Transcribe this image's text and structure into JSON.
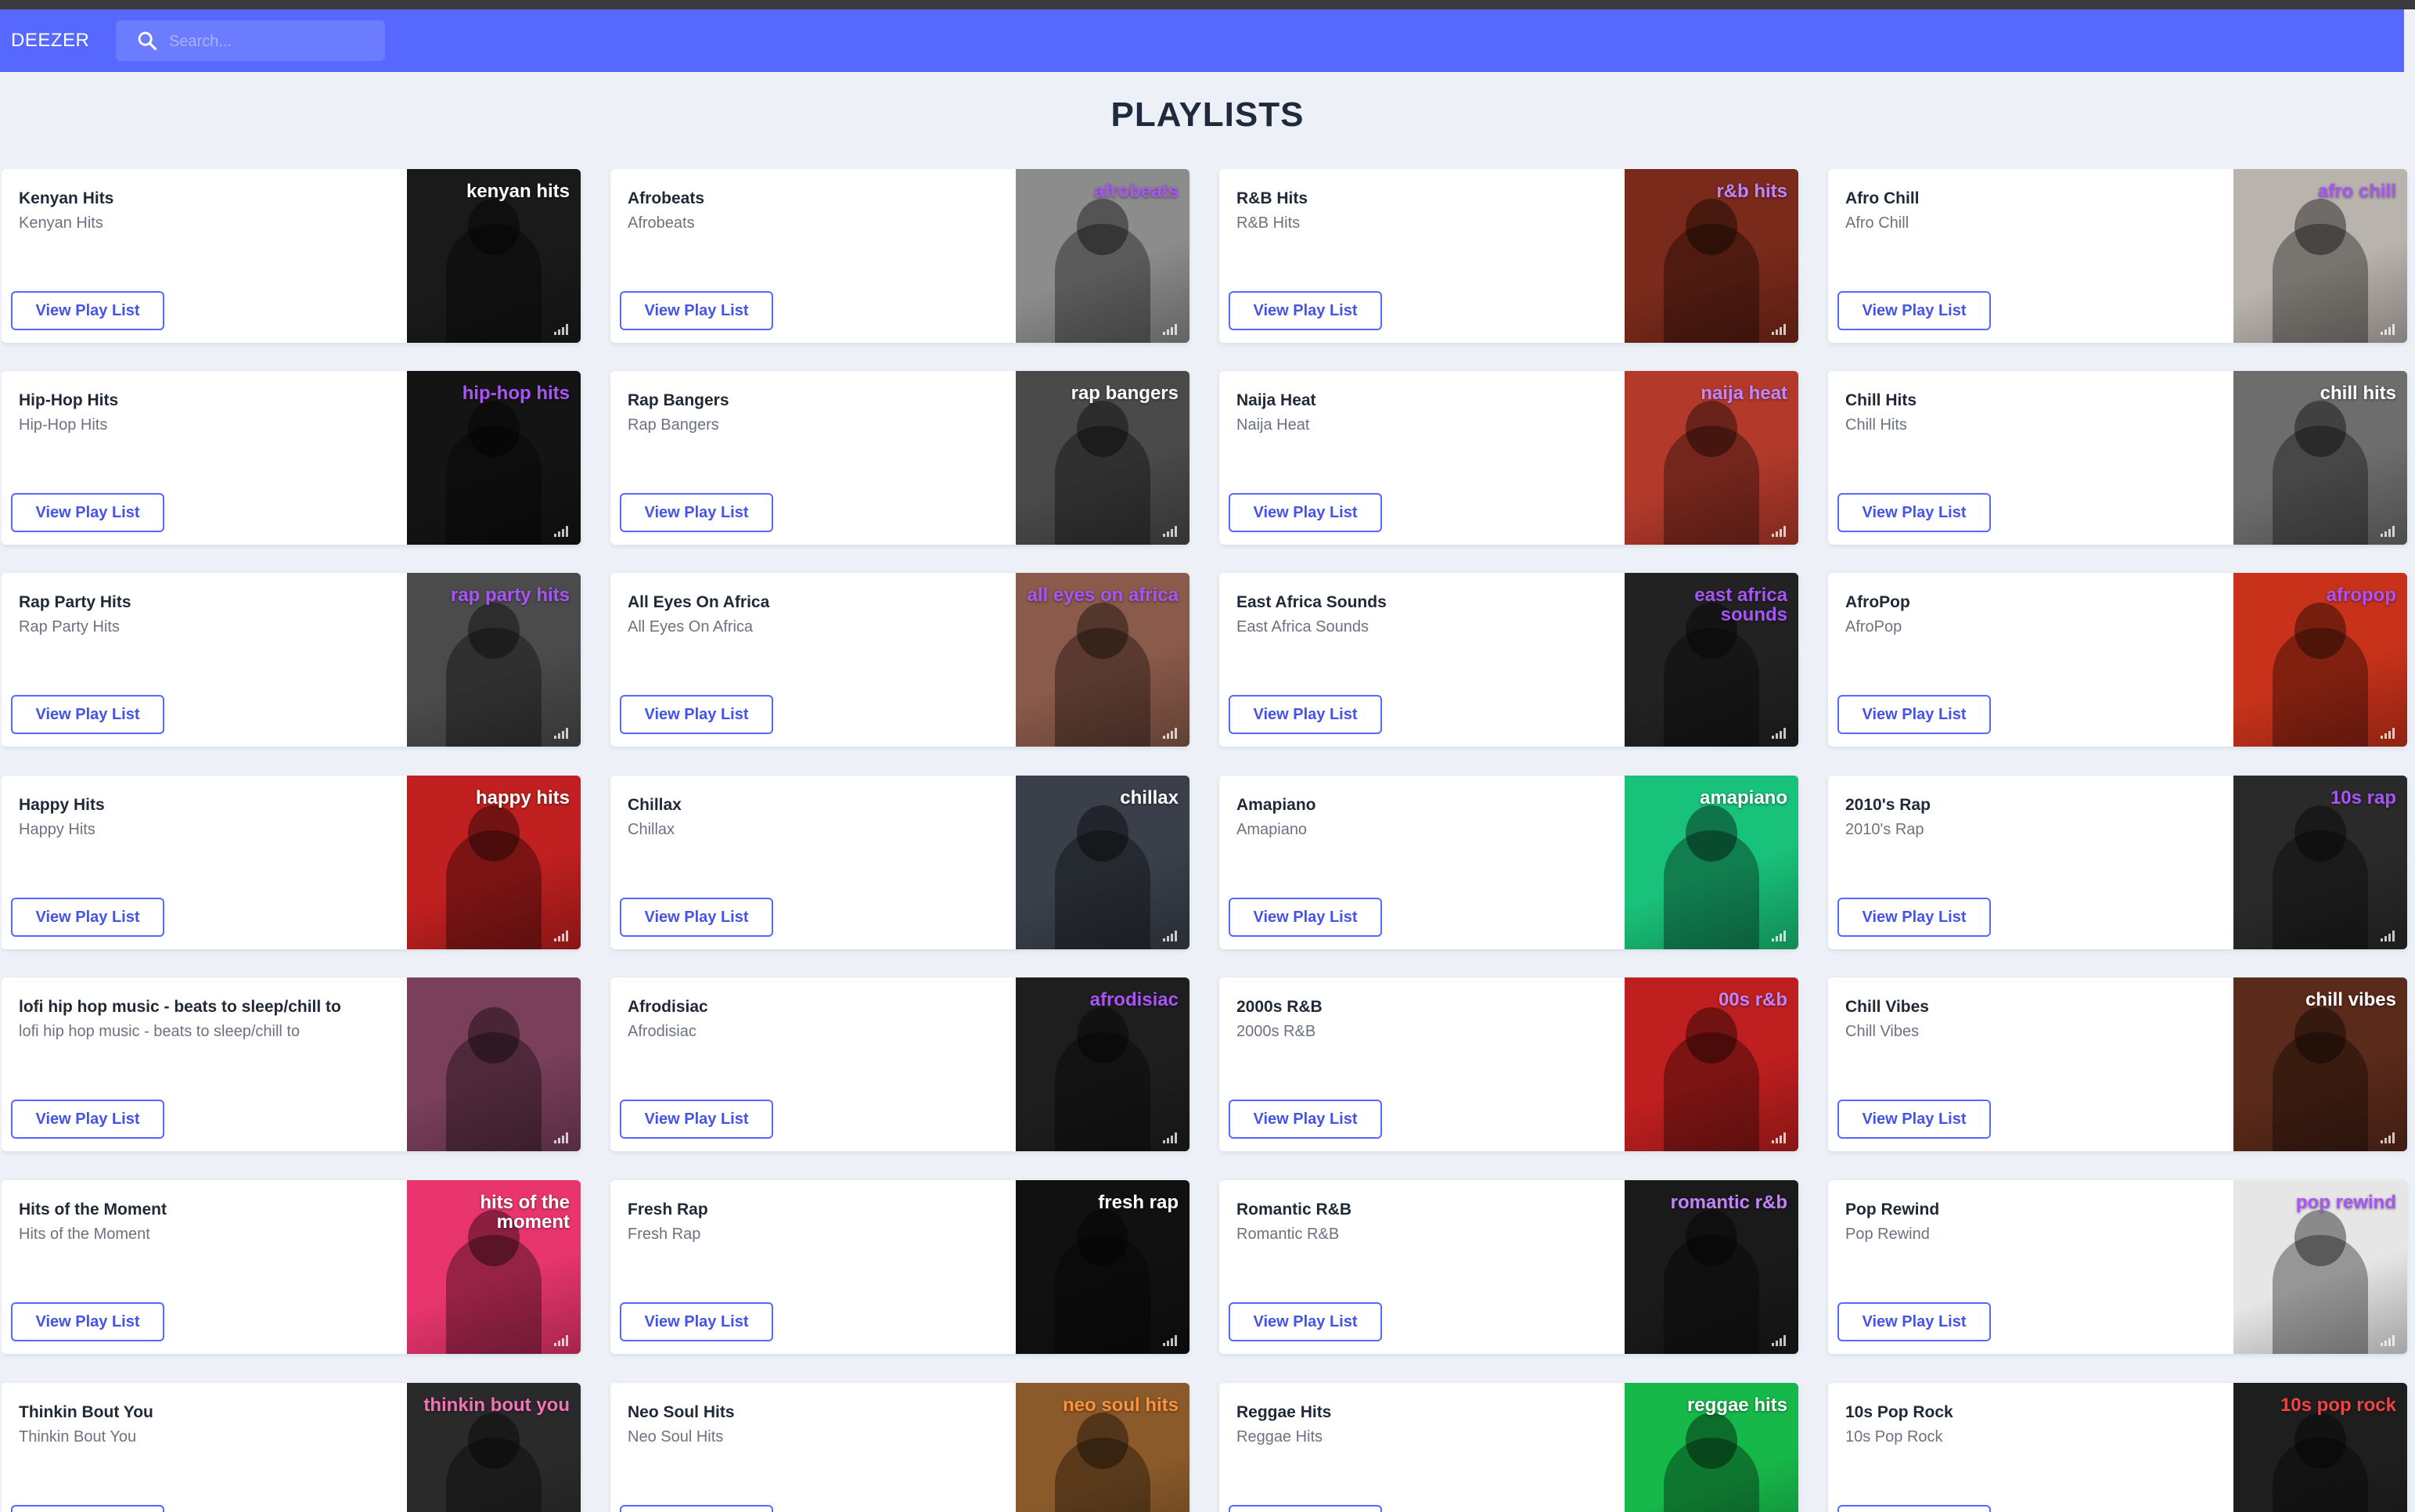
{
  "app": {
    "brand": "DEEZER"
  },
  "search": {
    "placeholder": "Search..."
  },
  "page_title": "PLAYLISTS",
  "button_label": "View Play List",
  "playlists": [
    {
      "title": "Kenyan Hits",
      "subtitle": "Kenyan Hits",
      "cover_text": "kenyan hits",
      "cover_color": "#1a1a1a",
      "accent_color": "#ffffff"
    },
    {
      "title": "Afrobeats",
      "subtitle": "Afrobeats",
      "cover_text": "afrobeats",
      "cover_color": "#8c8c8c",
      "accent_color": "#a855f7"
    },
    {
      "title": "R&B Hits",
      "subtitle": "R&B Hits",
      "cover_text": "r&b hits",
      "cover_color": "#7a2a1a",
      "accent_color": "#c084fc"
    },
    {
      "title": "Afro Chill",
      "subtitle": "Afro Chill",
      "cover_text": "afro chill",
      "cover_color": "#b9b3ad",
      "accent_color": "#a855f7"
    },
    {
      "title": "Hip-Hop Hits",
      "subtitle": "Hip-Hop Hits",
      "cover_text": "hip-hop hits",
      "cover_color": "#141414",
      "accent_color": "#a855f7"
    },
    {
      "title": "Rap Bangers",
      "subtitle": "Rap Bangers",
      "cover_text": "rap bangers",
      "cover_color": "#4a4a4a",
      "accent_color": "#ffffff"
    },
    {
      "title": "Naija Heat",
      "subtitle": "Naija Heat",
      "cover_text": "naija heat",
      "cover_color": "#b33a2b",
      "accent_color": "#c084fc"
    },
    {
      "title": "Chill Hits",
      "subtitle": "Chill Hits",
      "cover_text": "chill hits",
      "cover_color": "#6d6d6d",
      "accent_color": "#ffffff"
    },
    {
      "title": "Rap Party Hits",
      "subtitle": "Rap Party Hits",
      "cover_text": "rap party hits",
      "cover_color": "#4b4b4b",
      "accent_color": "#a855f7"
    },
    {
      "title": "All Eyes On Africa",
      "subtitle": "All Eyes On Africa",
      "cover_text": "all eyes on africa",
      "cover_color": "#8a5a4a",
      "accent_color": "#a855f7"
    },
    {
      "title": "East Africa Sounds",
      "subtitle": "East Africa Sounds",
      "cover_text": "east africa sounds",
      "cover_color": "#222222",
      "accent_color": "#a855f7"
    },
    {
      "title": "AfroPop",
      "subtitle": "AfroPop",
      "cover_text": "afropop",
      "cover_color": "#c8321a",
      "accent_color": "#a855f7"
    },
    {
      "title": "Happy Hits",
      "subtitle": "Happy Hits",
      "cover_text": "happy hits",
      "cover_color": "#c0201f",
      "accent_color": "#ffffff"
    },
    {
      "title": "Chillax",
      "subtitle": "Chillax",
      "cover_text": "chillax",
      "cover_color": "#3a3f4a",
      "accent_color": "#ffffff"
    },
    {
      "title": "Amapiano",
      "subtitle": "Amapiano",
      "cover_text": "amapiano",
      "cover_color": "#19c27a",
      "accent_color": "#ffffff"
    },
    {
      "title": "2010's Rap",
      "subtitle": "2010's Rap",
      "cover_text": "10s rap",
      "cover_color": "#2a2a2a",
      "accent_color": "#a855f7"
    },
    {
      "title": "lofi hip hop music - beats to sleep/chill to",
      "subtitle": "lofi hip hop music - beats to sleep/chill to",
      "cover_text": "",
      "cover_color": "#7a3f5a",
      "accent_color": "#ffffff"
    },
    {
      "title": "Afrodisiac",
      "subtitle": "Afrodisiac",
      "cover_text": "afrodisiac",
      "cover_color": "#1e1e1e",
      "accent_color": "#a855f7"
    },
    {
      "title": "2000s R&B",
      "subtitle": "2000s R&B",
      "cover_text": "00s r&b",
      "cover_color": "#c01f1f",
      "accent_color": "#c084fc"
    },
    {
      "title": "Chill Vibes",
      "subtitle": "Chill Vibes",
      "cover_text": "chill vibes",
      "cover_color": "#5a2a1a",
      "accent_color": "#ffffff"
    },
    {
      "title": "Hits of the Moment",
      "subtitle": "Hits of the Moment",
      "cover_text": "hits of the moment",
      "cover_color": "#e8356d",
      "accent_color": "#ffffff"
    },
    {
      "title": "Fresh Rap",
      "subtitle": "Fresh Rap",
      "cover_text": "fresh rap",
      "cover_color": "#111111",
      "accent_color": "#ffffff"
    },
    {
      "title": "Romantic R&B",
      "subtitle": "Romantic R&B",
      "cover_text": "romantic r&b",
      "cover_color": "#1a1a1a",
      "accent_color": "#c084fc"
    },
    {
      "title": "Pop Rewind",
      "subtitle": "Pop Rewind",
      "cover_text": "pop rewind",
      "cover_color": "#e6e6e6",
      "accent_color": "#a855f7"
    },
    {
      "title": "Thinkin Bout You",
      "subtitle": "Thinkin Bout You",
      "cover_text": "thinkin bout you",
      "cover_color": "#2a2a2a",
      "accent_color": "#f472b6"
    },
    {
      "title": "Neo Soul Hits",
      "subtitle": "Neo Soul Hits",
      "cover_text": "neo soul hits",
      "cover_color": "#8a5a2a",
      "accent_color": "#fb923c"
    },
    {
      "title": "Reggae Hits",
      "subtitle": "Reggae Hits",
      "cover_text": "reggae hits",
      "cover_color": "#17b84a",
      "accent_color": "#ffffff"
    },
    {
      "title": "10s Pop Rock",
      "subtitle": "10s Pop Rock",
      "cover_text": "10s pop rock",
      "cover_color": "#1e1e1e",
      "accent_color": "#ef4444"
    }
  ]
}
